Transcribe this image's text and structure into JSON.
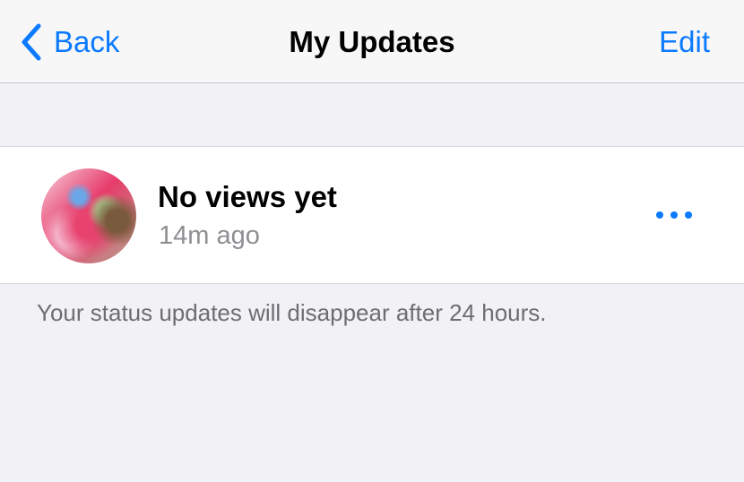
{
  "nav": {
    "back_label": "Back",
    "title": "My Updates",
    "edit_label": "Edit"
  },
  "status": {
    "views_text": "No views yet",
    "time_text": "14m ago",
    "more_icon": "ellipsis-icon",
    "avatar_icon": "status-thumbnail"
  },
  "footer": {
    "note": "Your status updates will disappear after 24 hours."
  },
  "colors": {
    "accent": "#0a7aff",
    "secondary_text": "#8e8e93",
    "background": "#f1f1f6"
  }
}
